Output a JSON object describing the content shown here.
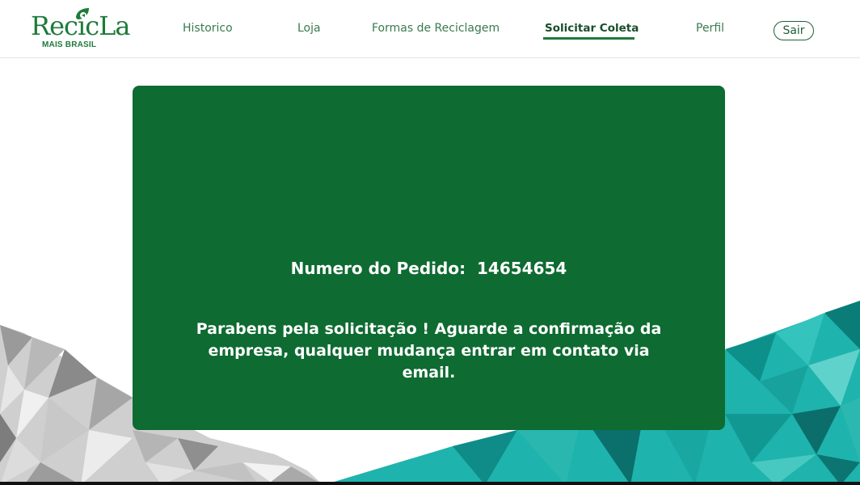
{
  "brand": {
    "name": "RecicLa",
    "subtitle": "MAIS BRASIL",
    "color": "#1f7a3a"
  },
  "nav": {
    "items": [
      {
        "label": "Historico"
      },
      {
        "label": "Loja"
      },
      {
        "label": "Formas de Reciclagem"
      },
      {
        "label": "Solicitar Coleta",
        "active": true
      },
      {
        "label": "Perfil"
      }
    ],
    "logout_label": "Sair"
  },
  "confirmation": {
    "order_label": "Numero do Pedido:",
    "order_number": "14654654",
    "message": "Parabens pela solicitação ! Aguarde a confirmação da empresa, qualquer mudança entrar em contato via email."
  },
  "colors": {
    "card": "#0e6b31",
    "accent": "#1f7a3a",
    "teal": "#0fa6a0"
  }
}
